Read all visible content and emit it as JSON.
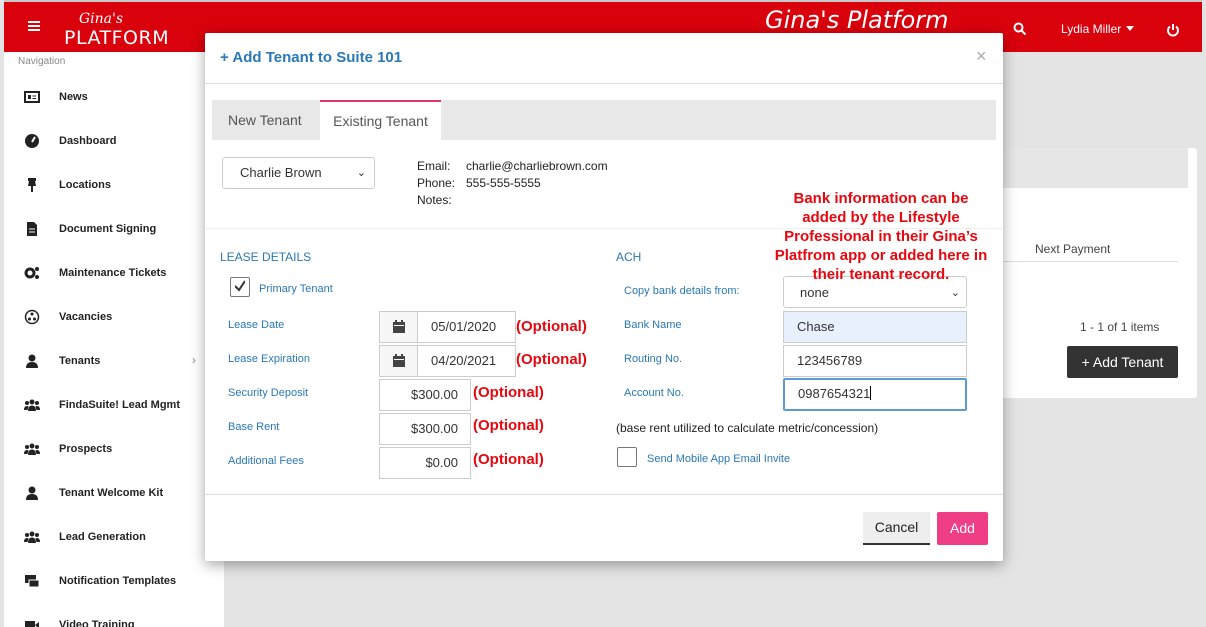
{
  "header": {
    "logo_script": "Gina's",
    "logo_main": "PLATFORM",
    "platform_title": "Gina's Platform",
    "user_name": "Lydia Miller",
    "brand_color": "#d9020c"
  },
  "sidebar": {
    "title": "Navigation",
    "items": [
      {
        "label": "News",
        "icon": "newspaper-icon"
      },
      {
        "label": "Dashboard",
        "icon": "gauge-icon"
      },
      {
        "label": "Locations",
        "icon": "pin-icon"
      },
      {
        "label": "Document Signing",
        "icon": "document-icon"
      },
      {
        "label": "Maintenance Tickets",
        "icon": "gears-icon"
      },
      {
        "label": "Vacancies",
        "icon": "circle-dots-icon"
      },
      {
        "label": "Tenants",
        "icon": "user-icon"
      },
      {
        "label": "FindaSuite! Lead Mgmt",
        "icon": "users-icon"
      },
      {
        "label": "Prospects",
        "icon": "users-icon"
      },
      {
        "label": "Tenant Welcome Kit",
        "icon": "user-icon"
      },
      {
        "label": "Lead Generation",
        "icon": "users-icon"
      },
      {
        "label": "Notification Templates",
        "icon": "templates-icon"
      },
      {
        "label": "Video Training",
        "icon": "video-icon"
      }
    ]
  },
  "background_card": {
    "column_header": "Next Payment",
    "count": "1 - 1 of 1 items",
    "add_button": "+ Add Tenant"
  },
  "modal": {
    "title": "+ Add Tenant to Suite 101",
    "close": "×",
    "tabs": [
      "New Tenant",
      "Existing Tenant"
    ],
    "selected_tenant": "Charlie Brown",
    "info": {
      "email_label": "Email:",
      "email": "charlie@charliebrown.com",
      "phone_label": "Phone:",
      "phone": "555-555-5555",
      "notes_label": "Notes:",
      "notes": ""
    },
    "lease": {
      "title": "LEASE DETAILS",
      "primary_tenant_label": "Primary Tenant",
      "primary_tenant_checked": true,
      "lease_date_label": "Lease Date",
      "lease_date": "05/01/2020",
      "lease_exp_label": "Lease Expiration",
      "lease_exp": "04/20/2021",
      "security_label": "Security Deposit",
      "security": "$300.00",
      "base_rent_label": "Base Rent",
      "base_rent": "$300.00",
      "fees_label": "Additional Fees",
      "fees": "$0.00"
    },
    "optional_label": "(Optional)",
    "ach": {
      "title": "ACH",
      "copy_label": "Copy bank details from:",
      "copy_value": "none",
      "bank_label": "Bank Name",
      "bank": "Chase",
      "routing_label": "Routing No.",
      "routing": "123456789",
      "account_label": "Account No.",
      "account": "0987654321"
    },
    "annotation": "Bank information can be added by the Lifestyle Professional in their Gina’s Platfrom app or added here in their tenant record.",
    "base_rent_note": "(base rent utilized to calculate metric/concession)",
    "send_invite_label": "Send Mobile App Email Invite",
    "cancel_label": "Cancel",
    "add_label": "Add",
    "accent_color": "#ef3d86"
  }
}
